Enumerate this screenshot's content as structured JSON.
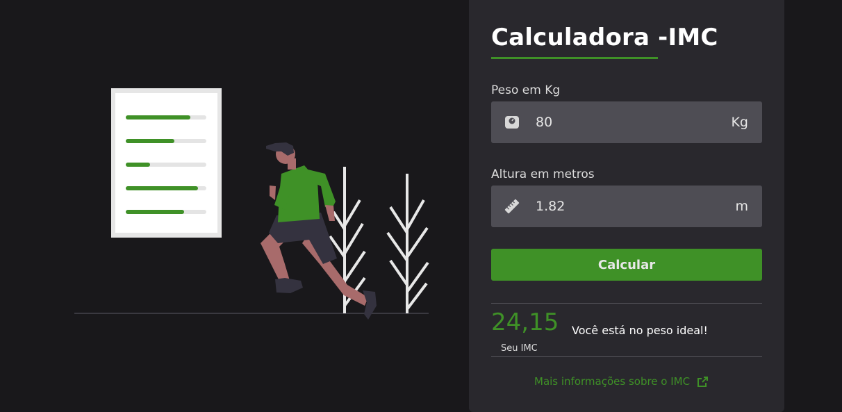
{
  "card": {
    "title": "Calculadora -IMC",
    "weight": {
      "label": "Peso em Kg",
      "value": "80",
      "unit": "Kg",
      "icon": "scale-icon"
    },
    "height": {
      "label": "Altura em metros",
      "value": "1.82",
      "unit": "m",
      "icon": "ruler-icon"
    },
    "calculate_label": "Calcular",
    "result": {
      "value": "24,15",
      "caption": "Seu IMC",
      "message": "Você está no peso ideal!"
    },
    "more_info_label": "Mais informações sobre o IMC",
    "more_info_icon": "external-link-icon"
  },
  "illustration": {
    "chart_bars": [
      0.8,
      0.6,
      0.3,
      0.9,
      0.72
    ]
  },
  "colors": {
    "accent": "#3f9127",
    "background": "#19181b",
    "card": "#29282d",
    "input": "#4e4d54"
  }
}
